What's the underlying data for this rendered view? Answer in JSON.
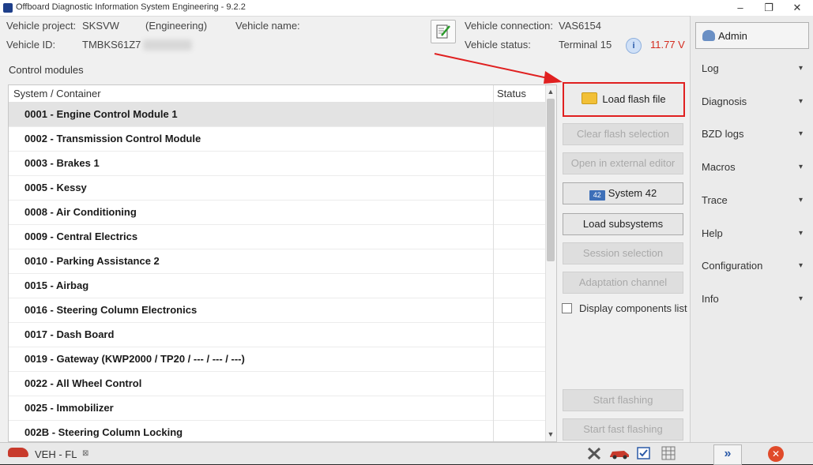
{
  "window": {
    "title": "Offboard Diagnostic Information System Engineering - 9.2.2",
    "minimize_glyph": "–",
    "restore_glyph": "❐",
    "close_glyph": "✕"
  },
  "header": {
    "vehicle_project_label": "Vehicle project:",
    "vehicle_project_value": "SKSVW",
    "mode": "(Engineering)",
    "vehicle_name_label": "Vehicle name:",
    "vehicle_id_label": "Vehicle ID:",
    "vehicle_id_value": "TMBKS61Z7",
    "vehicle_connection_label": "Vehicle connection:",
    "vehicle_connection_value": "VAS6154",
    "vehicle_status_label": "Vehicle status:",
    "vehicle_status_value": "Terminal 15",
    "voltage": "11.77 V",
    "voltage_color": "#d42a1e"
  },
  "control_modules": {
    "label": "Control modules",
    "columns": {
      "system": "System / Container",
      "status": "Status"
    },
    "rows": [
      "0001 - Engine Control Module 1",
      "0002 - Transmission Control Module",
      "0003 - Brakes 1",
      "0005 - Kessy",
      "0008 - Air Conditioning",
      "0009 - Central Electrics",
      "0010 - Parking Assistance 2",
      "0015 - Airbag",
      "0016 - Steering Column Electronics",
      "0017 - Dash Board",
      "0019 - Gateway  (KWP2000 / TP20 / --- / --- / ---)",
      "0022 - All Wheel Control",
      "0025 - Immobilizer",
      "002B - Steering Column Locking"
    ]
  },
  "actions": {
    "load_flash_file": "Load flash file",
    "clear_flash_selection": "Clear flash selection",
    "open_external_editor": "Open in external editor",
    "system_42": "System 42",
    "system_42_icon_text": "42",
    "load_subsystems": "Load subsystems",
    "session_selection": "Session selection",
    "adaptation_channel": "Adaptation channel",
    "display_components_list": "Display components list",
    "start_flashing": "Start flashing",
    "start_fast_flashing": "Start fast flashing"
  },
  "sidebar": {
    "admin_label": "Admin",
    "items": [
      "Log",
      "Diagnosis",
      "BZD logs",
      "Macros",
      "Trace",
      "Help",
      "Configuration",
      "Info"
    ]
  },
  "statusbar": {
    "tab_label": "VEH - FL",
    "tab_close_glyph": "⊠",
    "forward_glyph": "»",
    "stop_glyph": "✕"
  },
  "colors": {
    "highlight_red": "#e02020",
    "selected_row": "#e3e3e3"
  }
}
